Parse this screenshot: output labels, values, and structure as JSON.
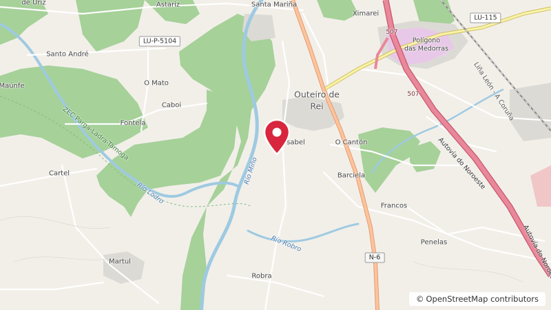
{
  "map": {
    "places": {
      "uriz": "de Uriz",
      "astariz": "Astariz",
      "santa_marina": "Santa Mariña",
      "ximarei": "Ximarei",
      "santo_andre": "Santo André",
      "maunfe": "Maúnfe",
      "o_mato": "O Mato",
      "caboi": "Caboi",
      "fontela": "Fontela",
      "cartel": "Cartel",
      "outeiro": "Outeiro de",
      "rei": "Rei",
      "isabel": "Isabel",
      "o_canton": "O Cantón",
      "barciela": "Barciela",
      "francos": "Francos",
      "penelas": "Penelas",
      "martul": "Martul",
      "robra": "Robra",
      "poligono_1": "Polígono",
      "poligono_2": "das Medorras"
    },
    "roads": {
      "lu_p_5104": "LU-P-5104",
      "lu_115": "LU-115",
      "n6": "N-6",
      "r507_a": "507",
      "r507_b": "507",
      "autovia_1": "Autovía do Noroeste",
      "autovia_2": "Autovía do Noroeste"
    },
    "rivers": {
      "minho": "Río Miño",
      "lodro": "Río Lodro",
      "robro": "Río Robro"
    },
    "areas": {
      "zec": "ZEC Parga-Ladra-Támoga"
    },
    "rail": {
      "linea": "Liña León - A Coruña"
    },
    "marker": {
      "icon": "map-pin-icon",
      "color": "#d7263d"
    },
    "attribution": {
      "text": "OpenStreetMap contributors",
      "symbol": "©"
    }
  }
}
